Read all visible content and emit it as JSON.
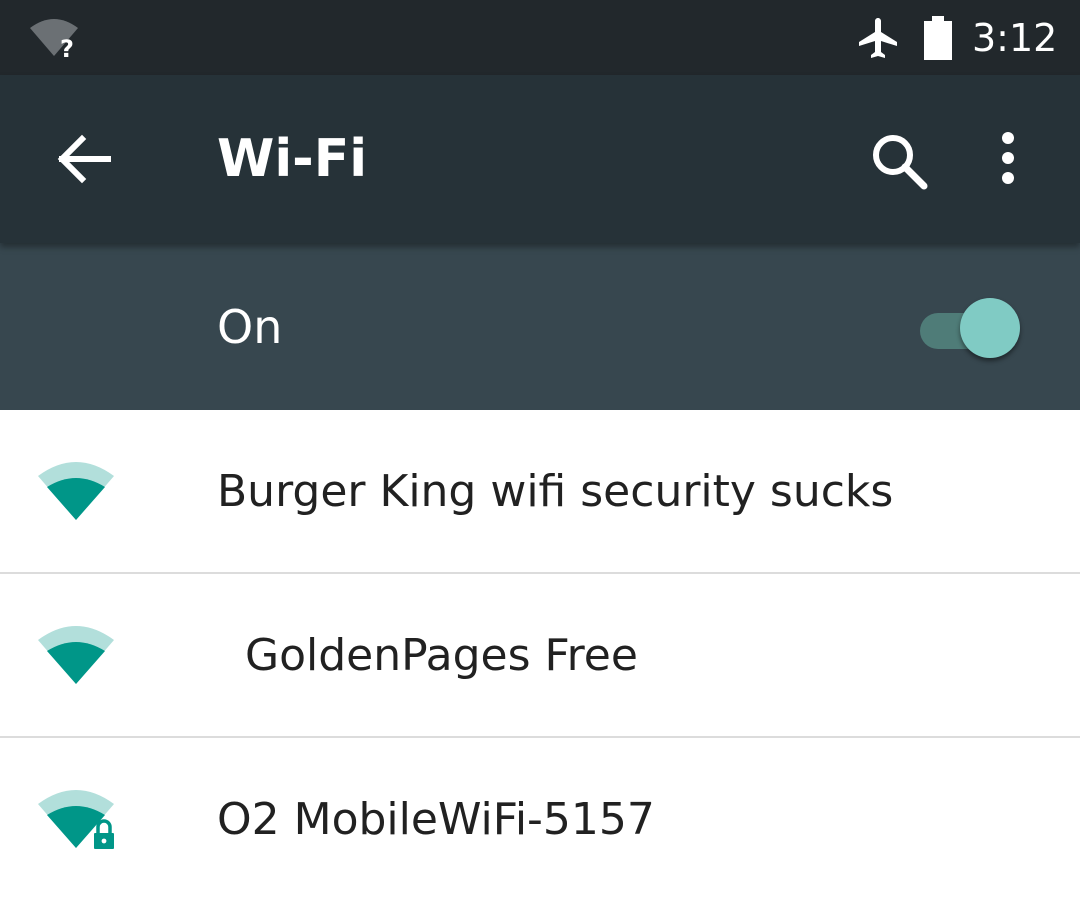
{
  "status_bar": {
    "time": "3:12",
    "wifi_icon": "wifi-unknown-icon",
    "wifi_glyph": "?",
    "airplane_icon": "airplane-mode-icon",
    "battery_icon": "battery-icon"
  },
  "app_bar": {
    "title": "Wi-Fi",
    "back_icon": "arrow-back-icon",
    "search_icon": "search-icon",
    "more_icon": "more-vert-icon"
  },
  "master_switch": {
    "label": "On",
    "state": "on"
  },
  "colors": {
    "status_bar": "#22282c",
    "app_bar": "#263238",
    "switch_bar": "#37474f",
    "accent": "#80cbc4",
    "signal": "#009688",
    "signal_faded": "#b2dfdb"
  },
  "networks": [
    {
      "ssid": "Burger King wifi security sucks",
      "secured": false,
      "icon": "wifi-signal-icon"
    },
    {
      "ssid": "  GoldenPages Free",
      "secured": false,
      "icon": "wifi-signal-icon"
    },
    {
      "ssid": "O2 MobileWiFi-5157",
      "secured": true,
      "icon": "wifi-signal-lock-icon"
    }
  ]
}
